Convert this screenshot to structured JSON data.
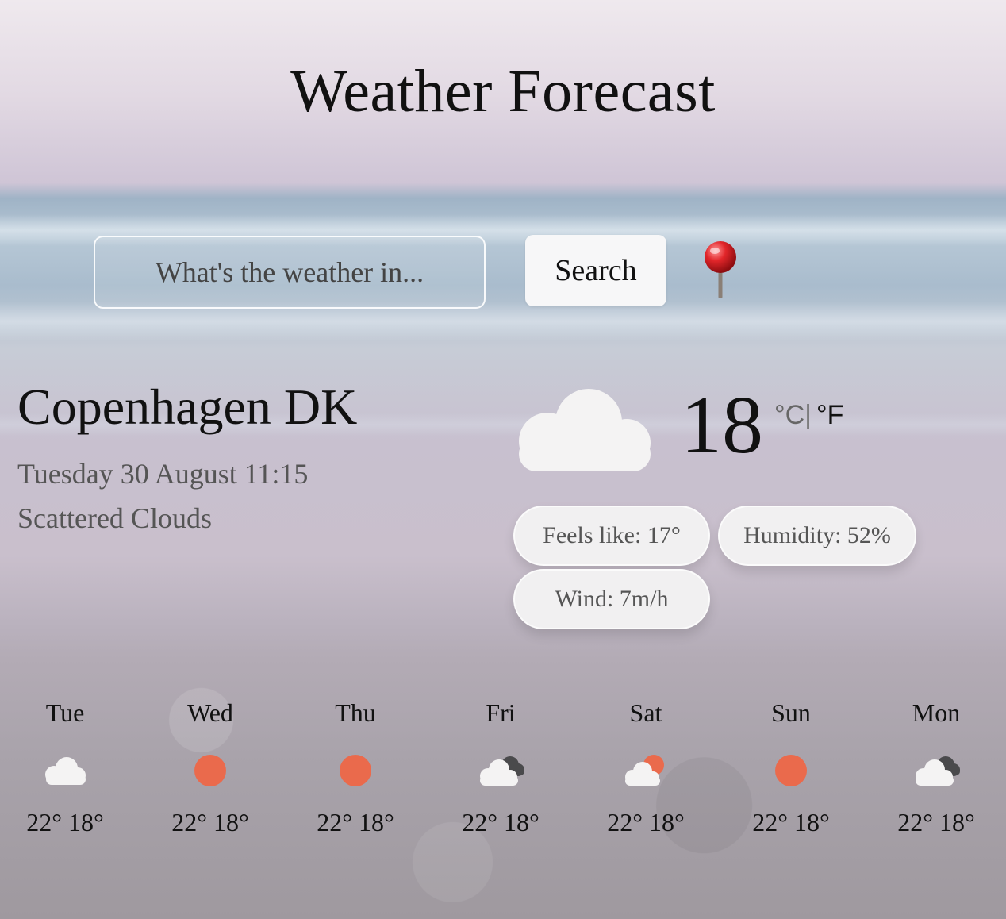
{
  "app": {
    "title": "Weather Forecast"
  },
  "search": {
    "placeholder": "What's the weather in...",
    "button_label": "Search",
    "location_icon": "round-pushpin-icon"
  },
  "current": {
    "city": "Copenhagen DK",
    "datetime": "Tuesday 30 August 11:15",
    "description": "Scattered Clouds",
    "icon": "cloud-icon",
    "temperature": "18",
    "unit_celsius": "°C",
    "unit_separator": "|",
    "unit_fahrenheit": "°F",
    "feels_like": "Feels like: 17°",
    "humidity": "Humidity: 52%",
    "wind": "Wind: 7m/h"
  },
  "forecast": [
    {
      "day": "Tue",
      "icon": "cloud-icon",
      "temps": "22° 18°"
    },
    {
      "day": "Wed",
      "icon": "sun-icon",
      "temps": "22° 18°"
    },
    {
      "day": "Thu",
      "icon": "sun-icon",
      "temps": "22° 18°"
    },
    {
      "day": "Fri",
      "icon": "dark-clouds-icon",
      "temps": "22° 18°"
    },
    {
      "day": "Sat",
      "icon": "sun-behind-cloud-icon",
      "temps": "22° 18°"
    },
    {
      "day": "Sun",
      "icon": "sun-icon",
      "temps": "22° 18°"
    },
    {
      "day": "Mon",
      "icon": "dark-clouds-icon",
      "temps": "22° 18°"
    }
  ],
  "colors": {
    "sun": "#ea6a4c",
    "cloud": "#f4f3f3",
    "dark_cloud": "#4a4a4c"
  }
}
